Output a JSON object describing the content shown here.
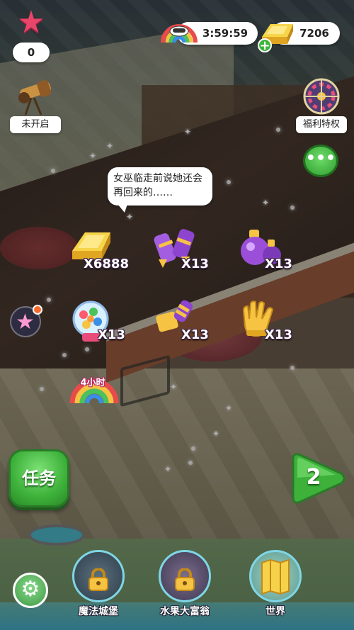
{
  "hud": {
    "star_count": "0",
    "timer": "3:59:59",
    "gold": "7206"
  },
  "side_buttons": {
    "left_label": "未开启",
    "right_label": "福利特权"
  },
  "speech": "女巫临走前说她还会再回来的……",
  "rewards": [
    {
      "name": "gold-bar",
      "qty": "X6888"
    },
    {
      "name": "rocket",
      "qty": "X13"
    },
    {
      "name": "potion",
      "qty": "X13"
    },
    {
      "name": "gumball",
      "qty": "X13"
    },
    {
      "name": "candy",
      "qty": "X13"
    },
    {
      "name": "glove",
      "qty": "X13"
    }
  ],
  "rainbow_timer": "4小时",
  "buttons": {
    "task": "任务",
    "level": "2"
  },
  "destinations": [
    {
      "label": "魔法城堡"
    },
    {
      "label": "水果大富翁"
    },
    {
      "label": "世界"
    }
  ],
  "icons": {
    "menu": "ellipsis-icon",
    "settings": "gear-icon",
    "add": "plus-icon"
  },
  "colors": {
    "green": "#3db13a",
    "pink_star": "#e8456b",
    "gold": "#f2c12e"
  }
}
